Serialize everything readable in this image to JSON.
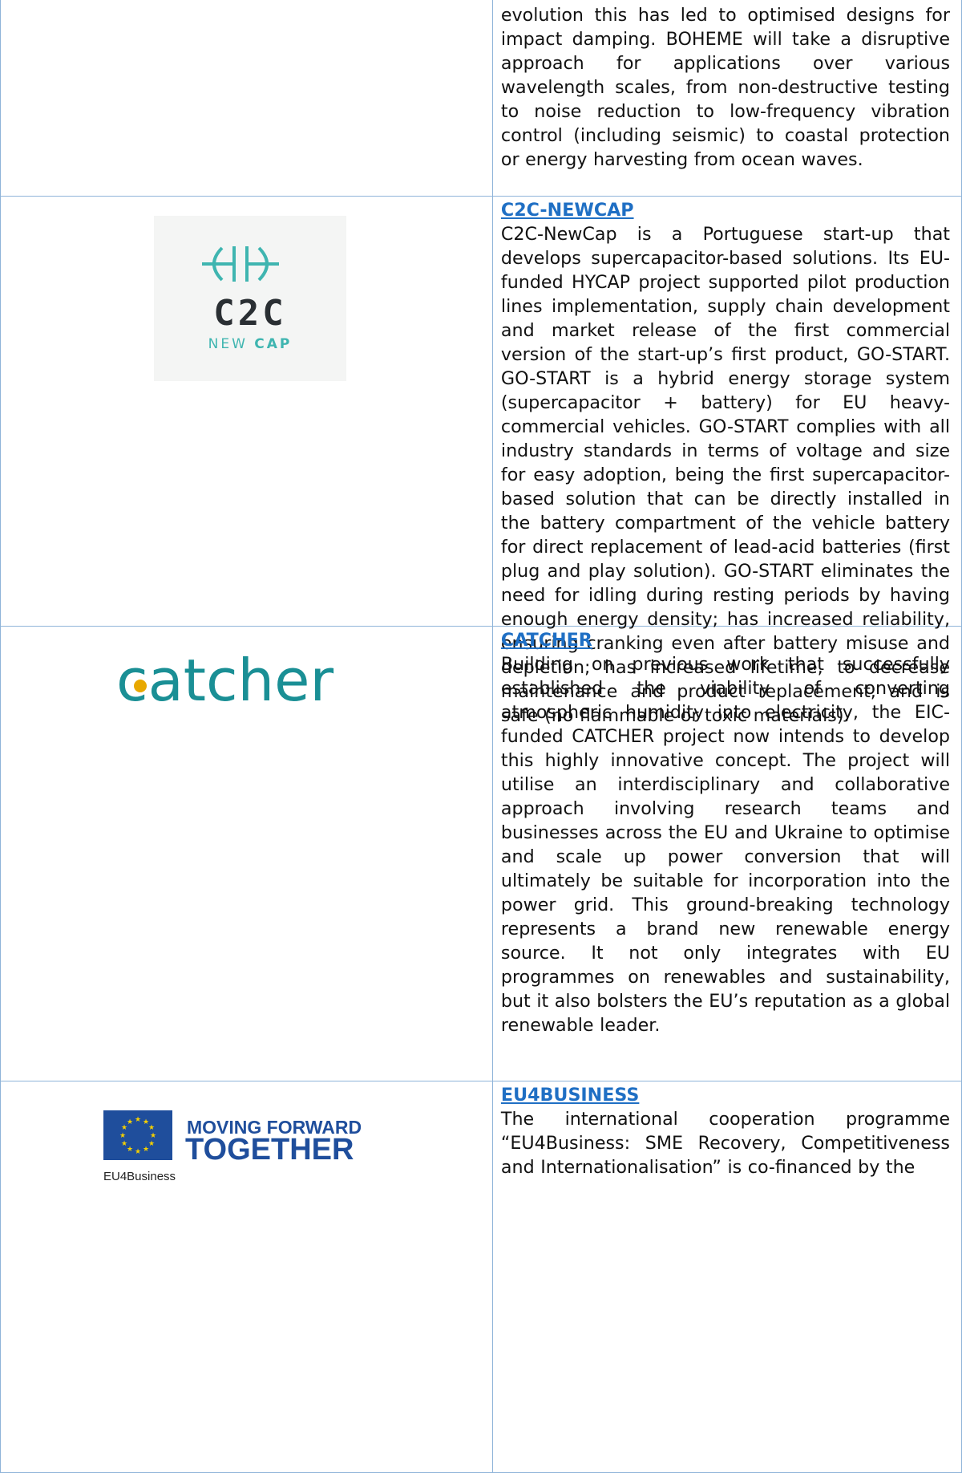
{
  "sections": [
    {
      "title": "",
      "body": "evolution this has led to optimised designs for impact damping. BOHEME will take a disruptive approach for applications over various wavelength scales, from non-destructive testing to noise reduction to low-frequency vibration control (including seismic) to coastal protection or energy harvesting from ocean waves."
    },
    {
      "title": "C2C-NEWCAP",
      "body": "C2C-NewCap is a Portuguese start-up that develops supercapacitor-based solutions. Its EU-funded HYCAP project supported pilot production lines implementation, supply chain development and market release of the first commercial version of the start-up’s first product, GO-START. GO-START is a hybrid energy storage system (supercapacitor + battery) for EU heavy-commercial vehicles. GO-START complies with all industry standards in terms of voltage and size for easy adoption, being the first supercapacitor-based solution that can be directly installed in the battery compartment of the vehicle battery for direct replacement of lead-acid batteries (first plug and play solution). GO-START eliminates the need for idling during resting periods by having enough energy density; has increased reliability, ensuring cranking even after battery misuse and depletion; has increased lifetime, to decrease maintenance and product replacement; and is safe (no flammable or toxic materials).",
      "logo": {
        "line1": "C2C",
        "line2a": "NEW ",
        "line2b": "CAP"
      }
    },
    {
      "title": "CATCHER",
      "body": "Building on previous work that successfully established the viability of converting atmospheric humidity into electricity, the EIC-funded CATCHER project now intends to develop this highly innovative concept. The project will utilise an interdisciplinary and collaborative approach involving research teams and businesses across the EU and Ukraine to optimise and scale up power conversion that will ultimately be suitable for incorporation into the power grid. This ground-breaking technology represents a brand new renewable energy source. It not only integrates with EU programmes on renewables and sustainability, but it also bolsters the EU’s reputation as a global renewable leader.",
      "logo": {
        "text": "catcher"
      }
    },
    {
      "title": "EU4BUSINESS",
      "body": "The international cooperation programme “EU4Business: SME Recovery, Competitiveness and Internationalisation” is co-financed by the",
      "logo": {
        "line1": "MOVING FORWARD",
        "line2": "TOGETHER",
        "caption": "EU4Business"
      }
    }
  ],
  "colors": {
    "link": "#1f6fc4",
    "border": "#8fb4d9",
    "c2c_teal": "#3fb5b0",
    "catcher_teal": "#1a8f95",
    "eu_blue": "#1f4e9c",
    "eu_star": "#f5d000"
  }
}
